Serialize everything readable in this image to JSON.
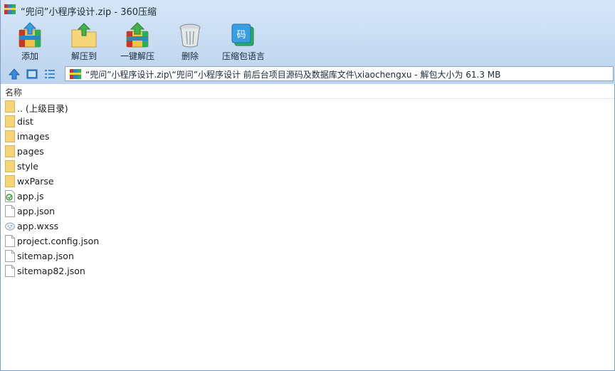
{
  "window": {
    "title": "“兜问”小程序设计.zip - 360压缩"
  },
  "toolbar": {
    "buttons": [
      {
        "label": "添加",
        "icon": "add-archive-icon"
      },
      {
        "label": "解压到",
        "icon": "extract-to-icon"
      },
      {
        "label": "一键解压",
        "icon": "one-click-extract-icon"
      },
      {
        "label": "删除",
        "icon": "trash-icon"
      },
      {
        "label": "压缩包语言",
        "icon": "archive-language-icon"
      }
    ]
  },
  "address": {
    "path": "“兜问”小程序设计.zip\\“兜问”小程序设计 前后台项目源码及数据库文件\\xiaochengxu - 解包大小为 61.3 MB"
  },
  "list": {
    "header_name": "名称",
    "items": [
      {
        "name": ".. (上级目录)",
        "type": "folder"
      },
      {
        "name": "dist",
        "type": "folder"
      },
      {
        "name": "images",
        "type": "folder"
      },
      {
        "name": "pages",
        "type": "folder"
      },
      {
        "name": "style",
        "type": "folder"
      },
      {
        "name": "wxParse",
        "type": "folder"
      },
      {
        "name": "app.js",
        "type": "js"
      },
      {
        "name": "app.json",
        "type": "file"
      },
      {
        "name": "app.wxss",
        "type": "wxss"
      },
      {
        "name": "project.config.json",
        "type": "file"
      },
      {
        "name": "sitemap.json",
        "type": "file"
      },
      {
        "name": "sitemap82.json",
        "type": "file"
      }
    ]
  },
  "colors": {
    "chrome_top": "#d6e6f7",
    "chrome_bottom": "#bcd4ef",
    "folder": "#f7d57a",
    "nav_blue": "#3b8ad8"
  }
}
